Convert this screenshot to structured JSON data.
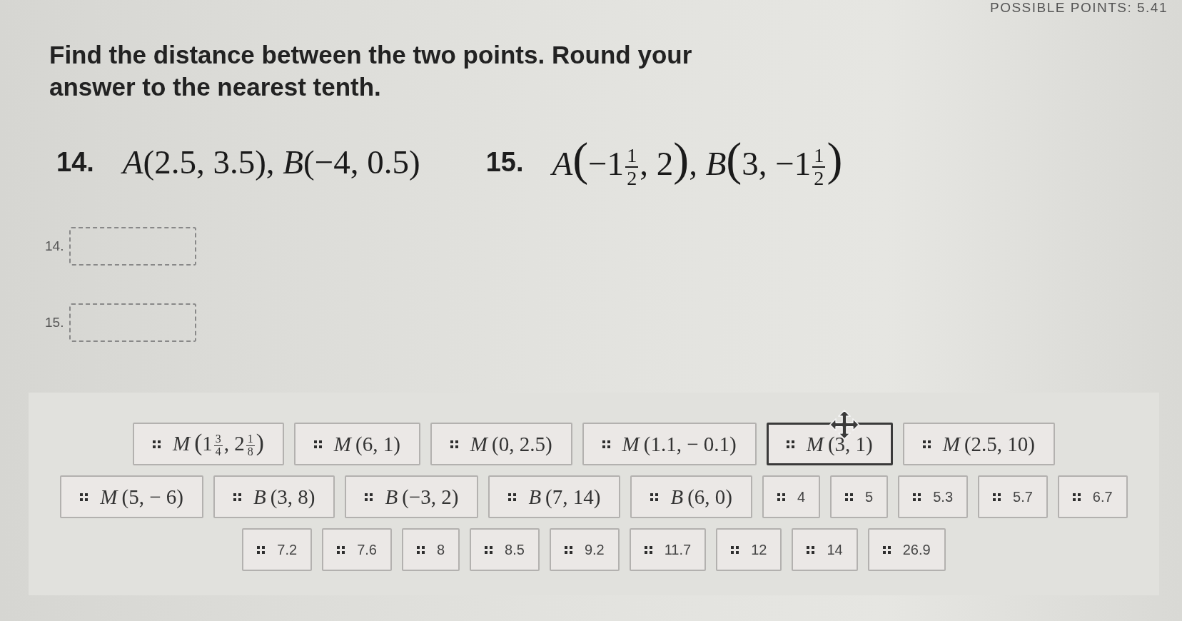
{
  "header": {
    "possible_points": "POSSIBLE POINTS: 5.41"
  },
  "instructions": "Find the distance between the two points. Round your answer to the nearest tenth.",
  "problems": [
    {
      "number": "14.",
      "expression": [
        {
          "kind": "var",
          "text": "A"
        },
        {
          "kind": "text",
          "text": "(2.5, 3.5), "
        },
        {
          "kind": "var",
          "text": "B"
        },
        {
          "kind": "text",
          "text": "(−4, 0.5)"
        }
      ]
    },
    {
      "number": "15.",
      "expression": [
        {
          "kind": "var",
          "text": "A"
        },
        {
          "kind": "paren",
          "text": "("
        },
        {
          "kind": "text",
          "text": "−1"
        },
        {
          "kind": "frac",
          "num": "1",
          "den": "2"
        },
        {
          "kind": "text",
          "text": ", 2"
        },
        {
          "kind": "paren",
          "text": ")"
        },
        {
          "kind": "text",
          "text": ", "
        },
        {
          "kind": "var",
          "text": "B"
        },
        {
          "kind": "paren",
          "text": "("
        },
        {
          "kind": "text",
          "text": "3, −1"
        },
        {
          "kind": "frac",
          "num": "1",
          "den": "2"
        },
        {
          "kind": "paren",
          "text": ")"
        }
      ]
    }
  ],
  "answers": [
    {
      "label": "14."
    },
    {
      "label": "15."
    }
  ],
  "tile_rows": [
    {
      "tiles": [
        {
          "kind": "point",
          "hovered": false,
          "tokens": [
            {
              "kind": "var",
              "text": "M"
            },
            {
              "kind": "paren",
              "text": "("
            },
            {
              "kind": "text",
              "text": "1"
            },
            {
              "kind": "frac",
              "num": "3",
              "den": "4"
            },
            {
              "kind": "text",
              "text": ", 2"
            },
            {
              "kind": "frac",
              "num": "1",
              "den": "8"
            },
            {
              "kind": "paren",
              "text": ")"
            }
          ]
        },
        {
          "kind": "point",
          "hovered": false,
          "tokens": [
            {
              "kind": "var",
              "text": "M"
            },
            {
              "kind": "text",
              "text": "(6, 1)"
            }
          ]
        },
        {
          "kind": "point",
          "hovered": false,
          "tokens": [
            {
              "kind": "var",
              "text": "M"
            },
            {
              "kind": "text",
              "text": "(0, 2.5)"
            }
          ]
        },
        {
          "kind": "point",
          "hovered": false,
          "tokens": [
            {
              "kind": "var",
              "text": "M"
            },
            {
              "kind": "text",
              "text": "(1.1, − 0.1)"
            }
          ]
        },
        {
          "kind": "point",
          "hovered": true,
          "tokens": [
            {
              "kind": "var",
              "text": "M"
            },
            {
              "kind": "text",
              "text": "(3, 1)"
            }
          ]
        },
        {
          "kind": "point",
          "hovered": false,
          "tokens": [
            {
              "kind": "var",
              "text": "M"
            },
            {
              "kind": "text",
              "text": "(2.5, 10)"
            }
          ]
        }
      ]
    },
    {
      "tiles": [
        {
          "kind": "point",
          "hovered": false,
          "tokens": [
            {
              "kind": "var",
              "text": "M"
            },
            {
              "kind": "text",
              "text": "(5, − 6)"
            }
          ]
        },
        {
          "kind": "point",
          "hovered": false,
          "tokens": [
            {
              "kind": "var",
              "text": "B"
            },
            {
              "kind": "text",
              "text": "(3, 8)"
            }
          ]
        },
        {
          "kind": "point",
          "hovered": false,
          "tokens": [
            {
              "kind": "var",
              "text": "B"
            },
            {
              "kind": "text",
              "text": "(−3, 2)"
            }
          ]
        },
        {
          "kind": "point",
          "hovered": false,
          "tokens": [
            {
              "kind": "var",
              "text": "B"
            },
            {
              "kind": "text",
              "text": "(7, 14)"
            }
          ]
        },
        {
          "kind": "point",
          "hovered": false,
          "tokens": [
            {
              "kind": "var",
              "text": "B"
            },
            {
              "kind": "text",
              "text": "(6, 0)"
            }
          ]
        },
        {
          "kind": "number",
          "hovered": false,
          "text": "4"
        },
        {
          "kind": "number",
          "hovered": false,
          "text": "5"
        },
        {
          "kind": "number",
          "hovered": false,
          "text": "5.3"
        },
        {
          "kind": "number",
          "hovered": false,
          "text": "5.7"
        },
        {
          "kind": "number",
          "hovered": false,
          "text": "6.7"
        }
      ]
    },
    {
      "tiles": [
        {
          "kind": "number",
          "hovered": false,
          "text": "7.2"
        },
        {
          "kind": "number",
          "hovered": false,
          "text": "7.6"
        },
        {
          "kind": "number",
          "hovered": false,
          "text": "8"
        },
        {
          "kind": "number",
          "hovered": false,
          "text": "8.5"
        },
        {
          "kind": "number",
          "hovered": false,
          "text": "9.2"
        },
        {
          "kind": "number",
          "hovered": false,
          "text": "11.7"
        },
        {
          "kind": "number",
          "hovered": false,
          "text": "12"
        },
        {
          "kind": "number",
          "hovered": false,
          "text": "14"
        },
        {
          "kind": "number",
          "hovered": false,
          "text": "26.9"
        }
      ]
    }
  ]
}
